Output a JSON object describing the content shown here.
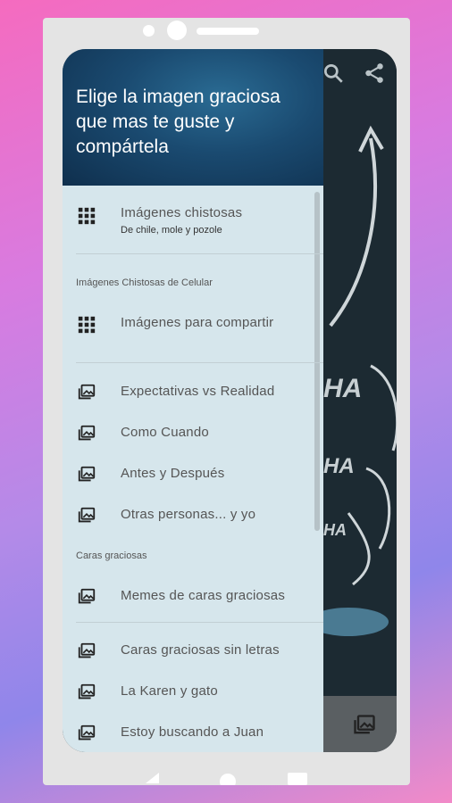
{
  "header": {
    "title": "Elige la imagen graciosa que mas te guste y compártela"
  },
  "appbar": {
    "icons": [
      "search-icon",
      "share-icon"
    ]
  },
  "sections": [
    {
      "label": "Imágenes Chistosas de Celular"
    },
    {
      "label": "Caras graciosas"
    }
  ],
  "items": [
    {
      "label": "Imágenes chistosas",
      "sublabel": "De chile, mole y pozole",
      "icon": "grid-icon"
    },
    {
      "label": "Imágenes para compartir",
      "icon": "grid-icon"
    },
    {
      "label": "Expectativas vs Realidad",
      "icon": "photo-library-icon"
    },
    {
      "label": "Como Cuando",
      "icon": "photo-library-icon"
    },
    {
      "label": "Antes y Después",
      "icon": "photo-library-icon"
    },
    {
      "label": "Otras personas... y yo",
      "icon": "photo-library-icon"
    },
    {
      "label": "Memes de caras graciosas",
      "icon": "photo-library-icon"
    },
    {
      "label": "Caras graciosas sin letras",
      "icon": "photo-library-icon"
    },
    {
      "label": "La Karen y gato",
      "icon": "photo-library-icon"
    },
    {
      "label": "Estoy buscando a Juan",
      "icon": "photo-library-icon"
    }
  ],
  "background": {
    "texts": [
      "HA",
      "HA",
      "HA"
    ]
  },
  "colors": {
    "drawer_bg": "#d6e6ec",
    "header_bg": "#1a4a70",
    "item_text": "#555555"
  }
}
